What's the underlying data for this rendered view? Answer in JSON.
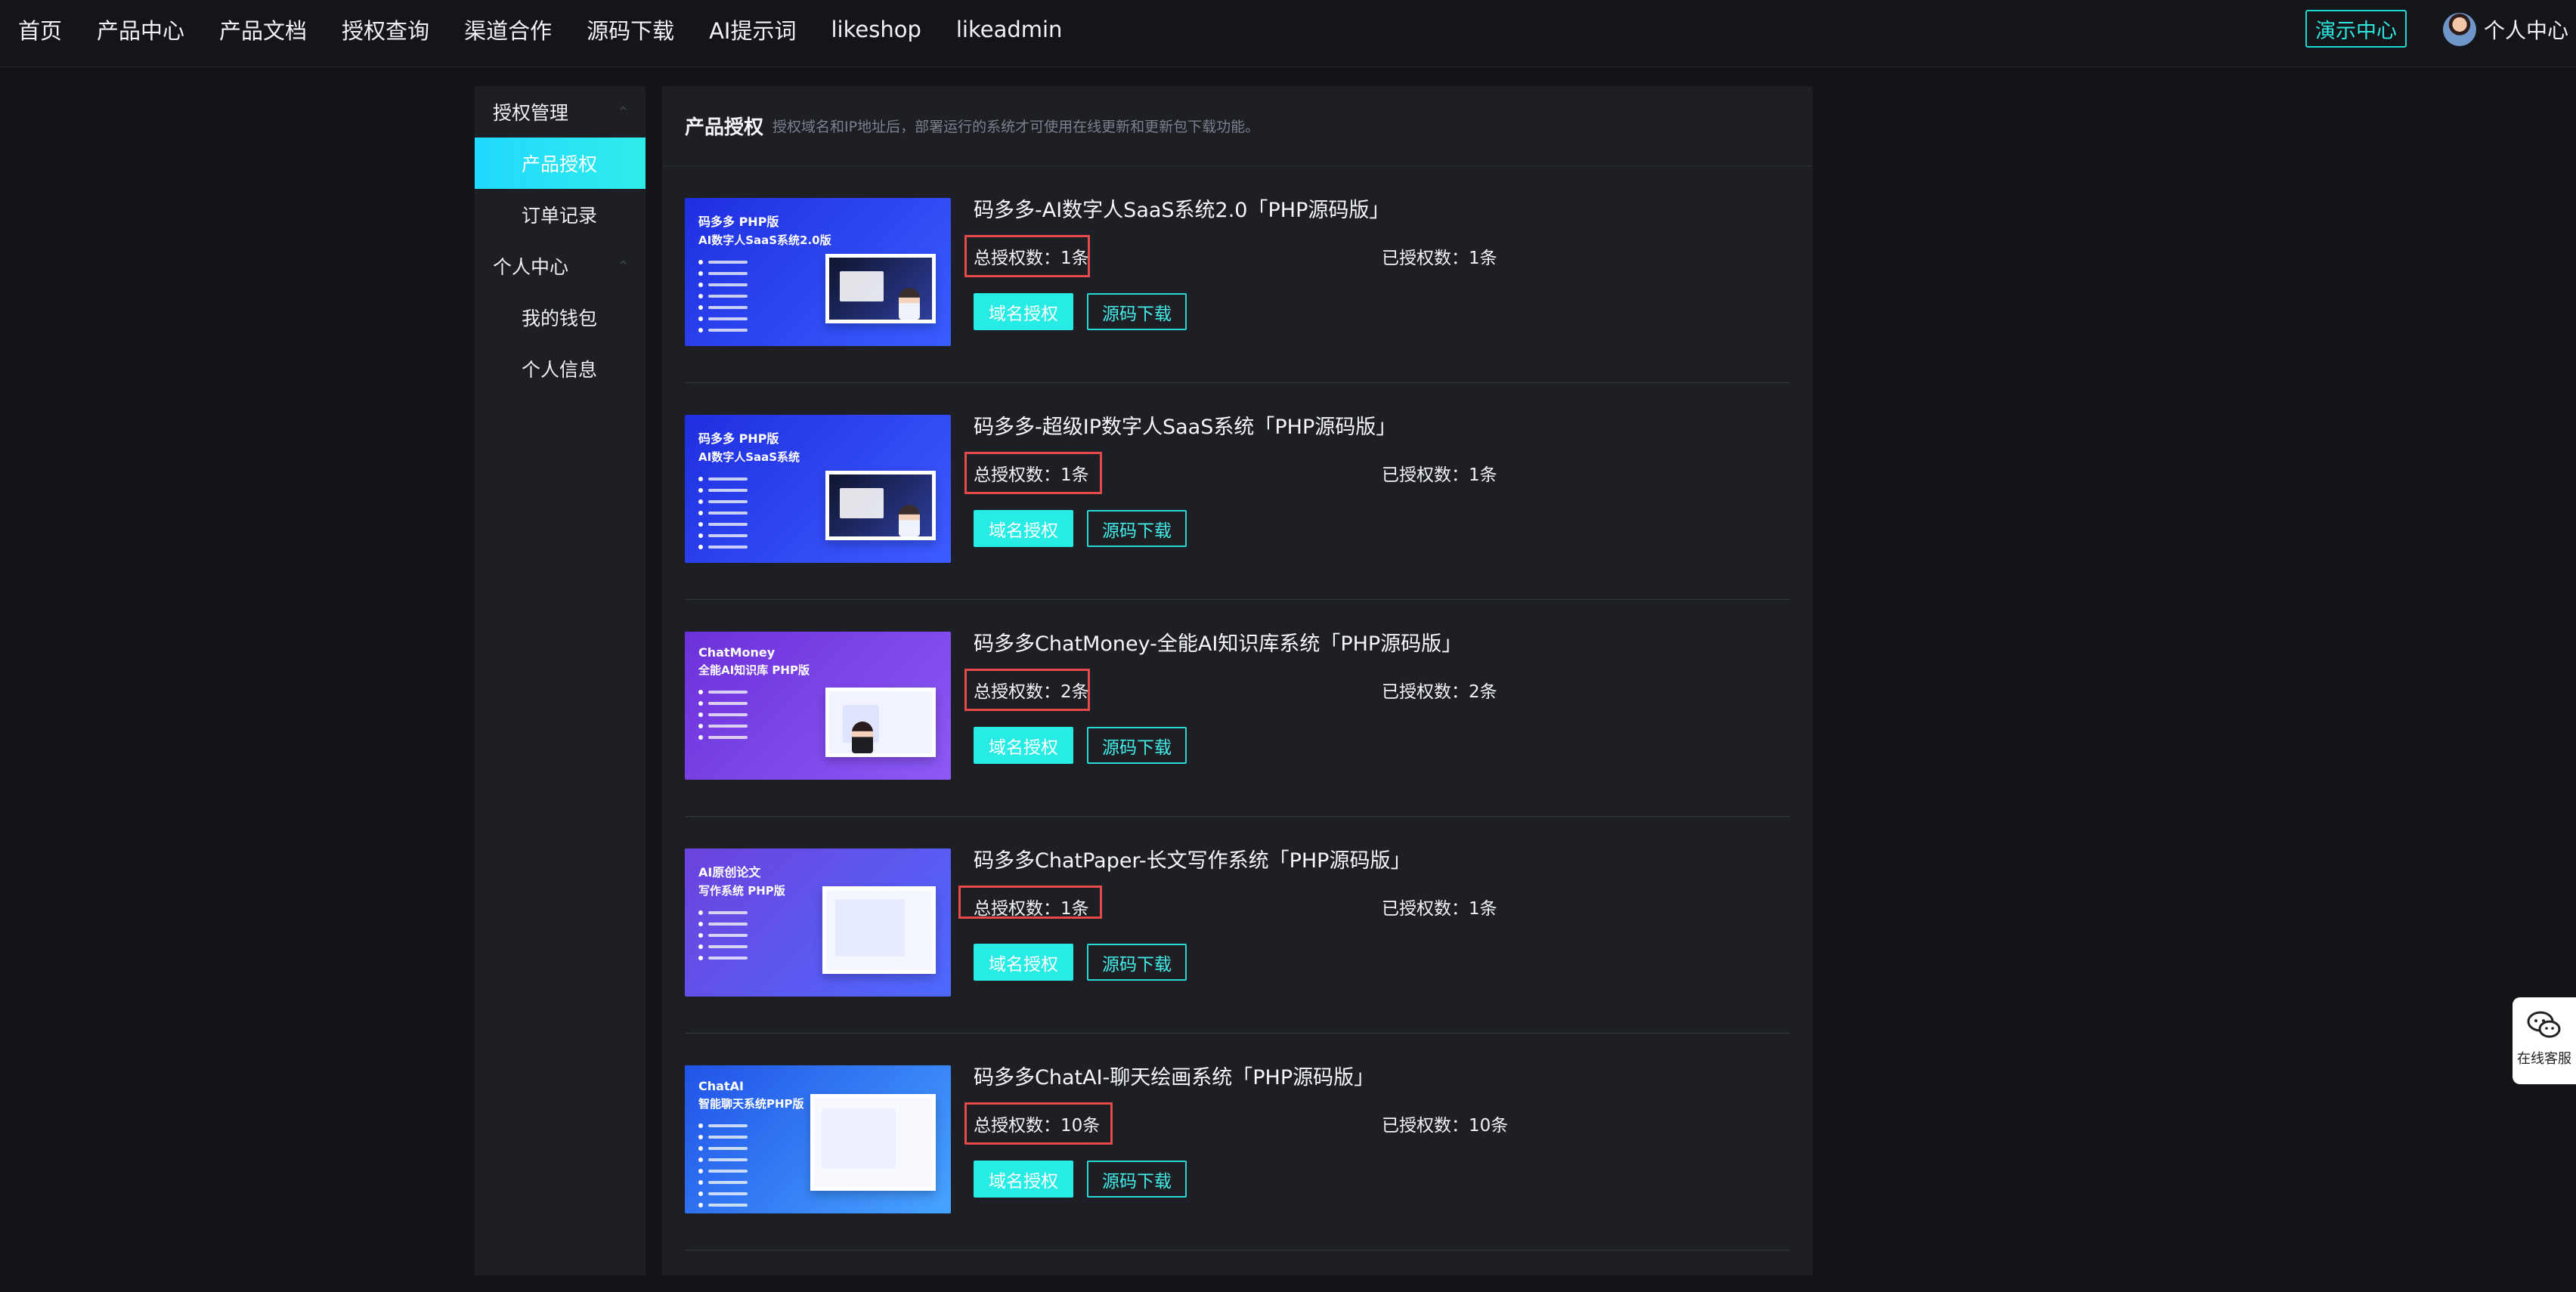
{
  "header": {
    "nav_items": [
      {
        "label": "首页"
      },
      {
        "label": "产品中心"
      },
      {
        "label": "产品文档"
      },
      {
        "label": "授权查询"
      },
      {
        "label": "渠道合作"
      },
      {
        "label": "源码下载"
      },
      {
        "label": "AI提示词"
      },
      {
        "label": "likeshop"
      },
      {
        "label": "likeadmin"
      }
    ],
    "demo_center": "演示中心",
    "user_center": "个人中心"
  },
  "sidebar": {
    "groups": [
      {
        "label": "授权管理",
        "items": [
          "产品授权",
          "订单记录"
        ]
      },
      {
        "label": "个人中心",
        "items": [
          "我的钱包",
          "个人信息"
        ]
      }
    ]
  },
  "panel": {
    "title": "产品授权",
    "description": "授权域名和IP地址后，部署运行的系统才可使用在线更新和更新包下载功能。"
  },
  "products": [
    {
      "title": "码多多-AI数字人SaaS系统2.0「PHP源码版」",
      "total_auth": "总授权数：1条",
      "authorized": "已授权数：1条",
      "domain_button": "域名授权",
      "source_button": "源码下载",
      "thumbnail": {
        "brand": "码多多 PHP版",
        "subtitle": "AI数字人SaaS系统2.0版",
        "bg1": "#1f2fe0",
        "bg2": "#3a5dff"
      }
    },
    {
      "title": "码多多-超级IP数字人SaaS系统「PHP源码版」",
      "total_auth": "总授权数：1条",
      "authorized": "已授权数：1条",
      "domain_button": "域名授权",
      "source_button": "源码下载",
      "thumbnail": {
        "brand": "码多多 PHP版",
        "subtitle": "AI数字人SaaS系统",
        "bg1": "#1f2fe0",
        "bg2": "#3d5cff"
      }
    },
    {
      "title": "码多多ChatMoney-全能AI知识库系统「PHP源码版」",
      "total_auth": "总授权数：2条",
      "authorized": "已授权数：2条",
      "domain_button": "域名授权",
      "source_button": "源码下载",
      "thumbnail": {
        "brand": "ChatMoney",
        "subtitle": "全能AI知识库 PHP版",
        "bg1": "#6c32d9",
        "bg2": "#8c59f6"
      }
    },
    {
      "title": "码多多ChatPaper-长文写作系统「PHP源码版」",
      "total_auth": "总授权数：1条",
      "authorized": "已授权数：1条",
      "domain_button": "域名授权",
      "source_button": "源码下载",
      "thumbnail": {
        "brand": "AI原创论文",
        "subtitle": "写作系统 PHP版",
        "bg1": "#6d43dd",
        "bg2": "#4d69ff"
      }
    },
    {
      "title": "码多多ChatAI-聊天绘画系统「PHP源码版」",
      "total_auth": "总授权数：10条",
      "authorized": "已授权数：10条",
      "domain_button": "域名授权",
      "source_button": "源码下载",
      "thumbnail": {
        "brand": "ChatAI",
        "subtitle": "智能聊天系统PHP版",
        "bg1": "#2153e8",
        "bg2": "#47a4ff"
      }
    }
  ],
  "floating": {
    "service_label": "在线客服"
  },
  "colors": {
    "accent": "#27ebe5",
    "highlight_box": "#e54a4a",
    "panel_bg": "#1d1f25"
  },
  "icons": {
    "service": "wechat-icon",
    "collapse": "chevron-up-icon"
  }
}
